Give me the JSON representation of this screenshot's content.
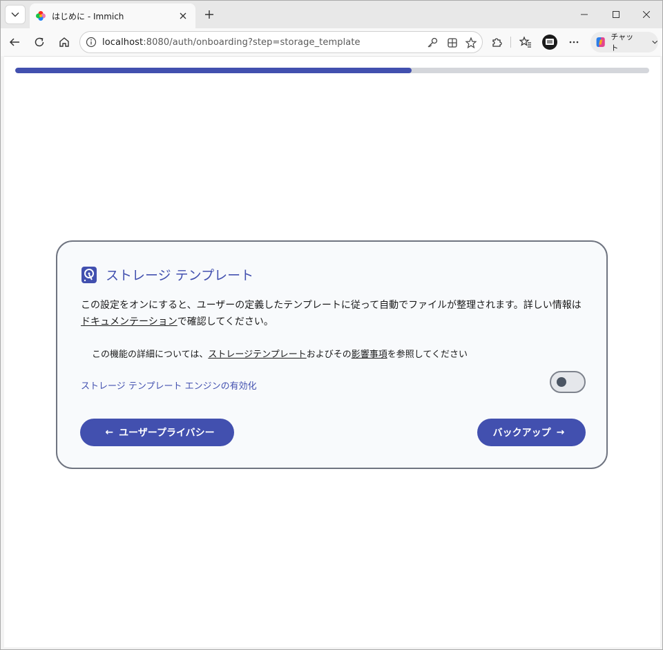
{
  "browser": {
    "tab_title": "はじめに - Immich",
    "url_host": "localhost",
    "url_rest": ":8080/auth/onboarding?step=storage_template",
    "chat_label": "チャット"
  },
  "onboarding": {
    "progress_percent": 62.5,
    "title": "ストレージ テンプレート",
    "description_pre": "この設定をオンにすると、ユーザーの定義したテンプレートに従って自動でファイルが整理されます。詳しい情報は",
    "description_link": "ドキュメンテーション",
    "description_post": "で確認してください。",
    "note_pre": "この機能の詳細については、",
    "note_link1": "ストレージテンプレート",
    "note_mid": "およびその",
    "note_link2": "影響事項",
    "note_post": "を参照してください",
    "setting_label": "ストレージ テンプレート エンジンの有効化",
    "toggle_on": false,
    "back_label": "ユーザープライバシー",
    "next_label": "バックアップ"
  },
  "colors": {
    "accent": "#4250af",
    "progress_track": "#d4d6db",
    "card_bg": "#f8fafc",
    "card_border": "#6f7480"
  },
  "icons": [
    "chevron-down-icon",
    "immich-logo-icon",
    "close-icon",
    "plus-icon",
    "minimize-icon",
    "maximize-icon",
    "back-arrow-icon",
    "refresh-icon",
    "home-icon",
    "info-icon",
    "key-icon",
    "grid-icon",
    "star-icon",
    "extension-icon",
    "favorites-icon",
    "profile-icon",
    "more-icon",
    "copilot-icon",
    "storage-template-icon",
    "arrow-left-icon",
    "arrow-right-icon"
  ]
}
